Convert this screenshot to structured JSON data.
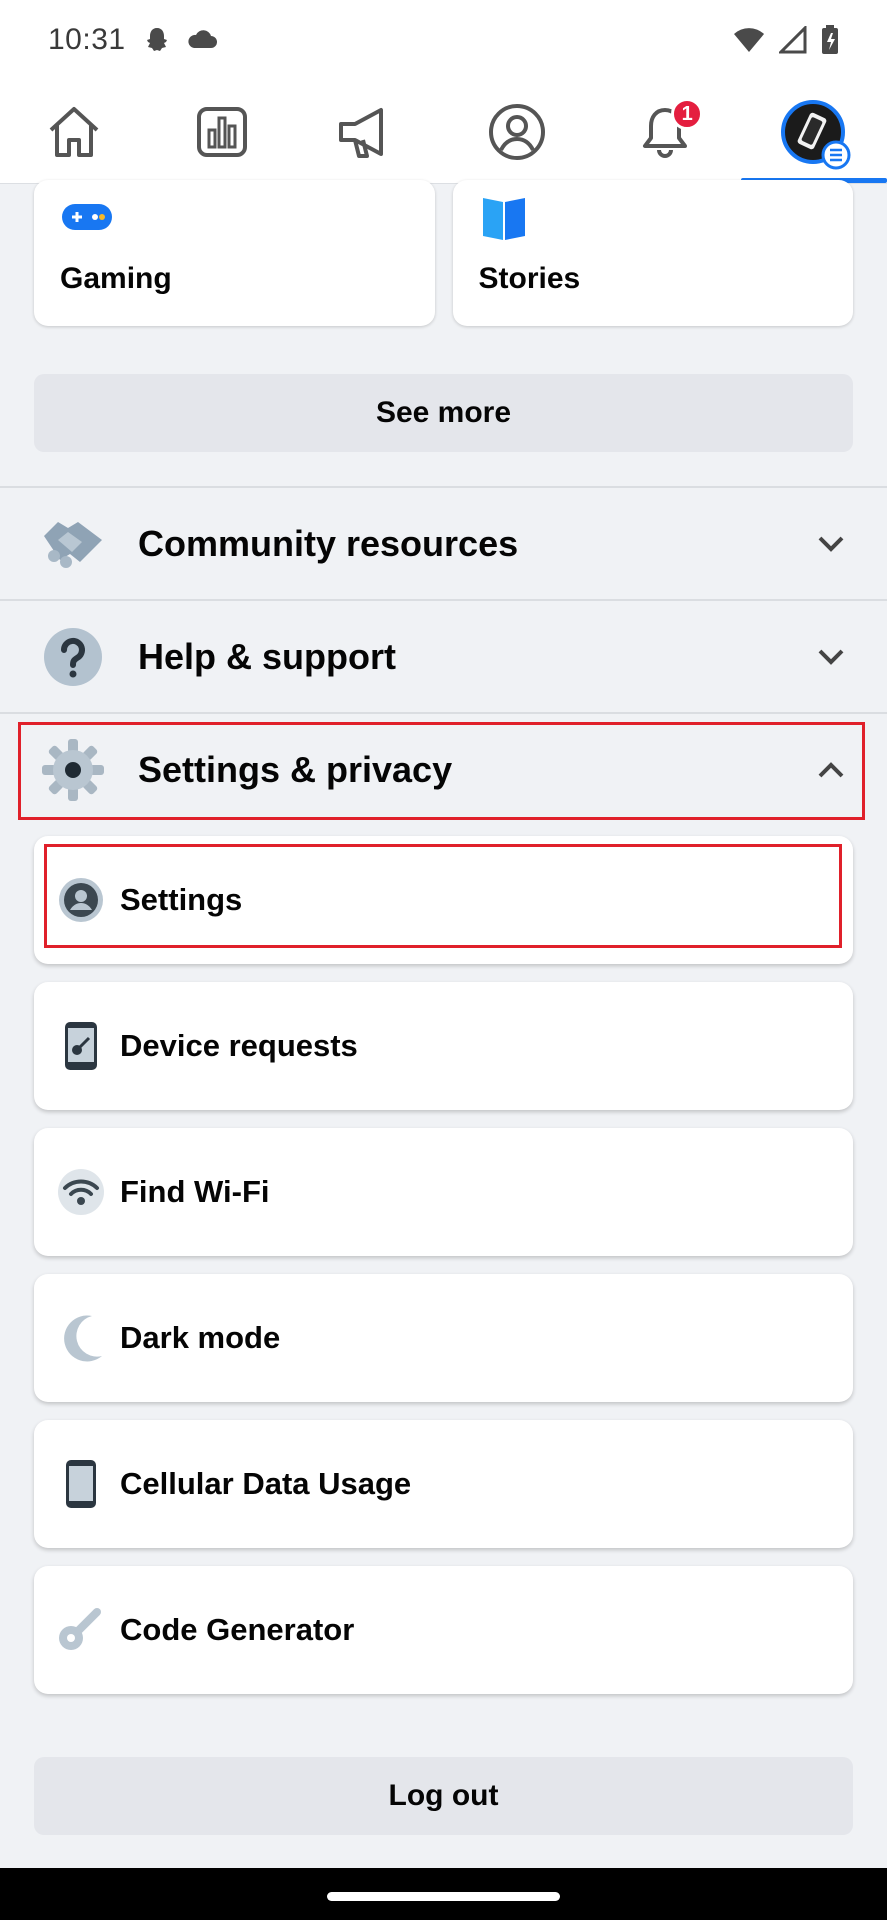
{
  "status_bar": {
    "time": "10:31"
  },
  "nav": {
    "notification_count": "1",
    "tabs": [
      "home",
      "dashboard",
      "ads",
      "profile",
      "notifications",
      "menu"
    ]
  },
  "shortcuts": [
    {
      "label": "Gaming",
      "icon": "gaming-controller-icon"
    },
    {
      "label": "Stories",
      "icon": "stories-book-icon"
    }
  ],
  "see_more": "See more",
  "sections": {
    "community": "Community resources",
    "help": "Help & support",
    "settings_privacy": "Settings & privacy"
  },
  "menu_items": {
    "settings": "Settings",
    "device_requests": "Device requests",
    "find_wifi": "Find Wi-Fi",
    "dark_mode": "Dark mode",
    "cellular": "Cellular Data Usage",
    "code_generator": "Code Generator"
  },
  "log_out": "Log out",
  "colors": {
    "accent": "#1877f2",
    "highlight": "#e0202a",
    "badge": "#e41e3f"
  }
}
